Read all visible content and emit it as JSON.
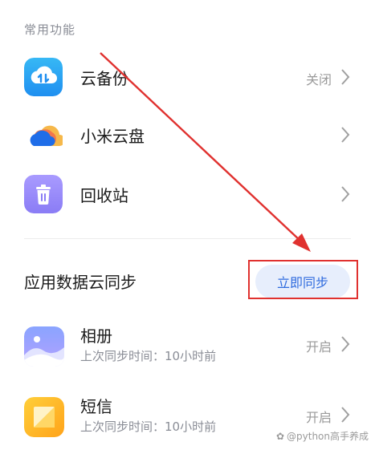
{
  "common": {
    "title": "常用功能",
    "items": [
      {
        "label": "云备份",
        "status": "关闭"
      },
      {
        "label": "小米云盘",
        "status": ""
      },
      {
        "label": "回收站",
        "status": ""
      }
    ]
  },
  "sync": {
    "header": "应用数据云同步",
    "button_label": "立即同步",
    "apps": [
      {
        "label": "相册",
        "sub": "上次同步时间：10小时前",
        "status": "开启"
      },
      {
        "label": "短信",
        "sub": "上次同步时间：10小时前",
        "status": "开启"
      }
    ]
  },
  "watermark": {
    "text": "@python高手养成"
  },
  "colors": {
    "accent": "#2f6bde",
    "button_bg": "#e7eefc",
    "annotation": "#e0312f"
  }
}
